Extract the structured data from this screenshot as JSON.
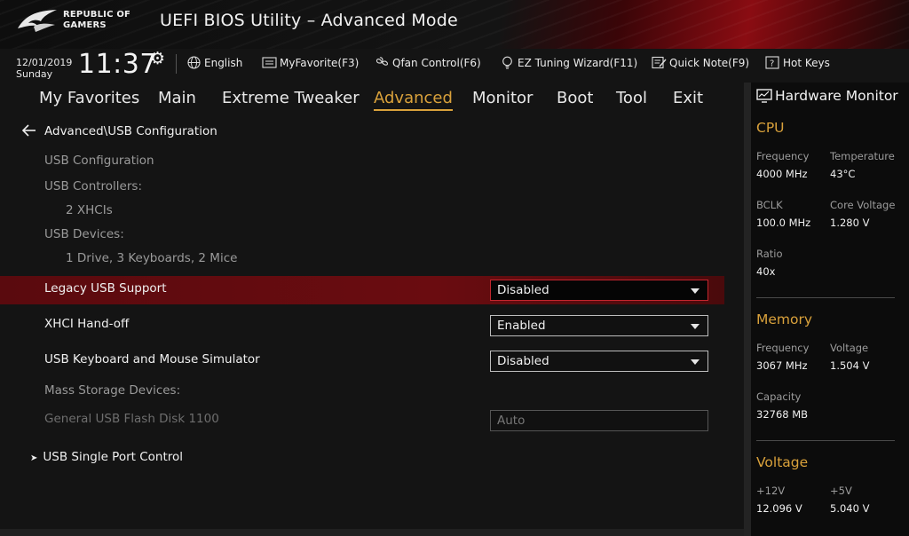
{
  "header": {
    "logo_line1": "REPUBLIC OF",
    "logo_line2": "GAMERS",
    "title": "UEFI BIOS Utility – Advanced Mode"
  },
  "status": {
    "date": "12/01/2019",
    "day": "Sunday",
    "time": "11:37",
    "tools": [
      {
        "label": "English",
        "icon": "globe-icon"
      },
      {
        "label": "MyFavorite(F3)",
        "icon": "favorite-icon"
      },
      {
        "label": "Qfan Control(F6)",
        "icon": "fan-icon"
      },
      {
        "label": "EZ Tuning Wizard(F11)",
        "icon": "bulb-icon"
      },
      {
        "label": "Quick Note(F9)",
        "icon": "note-icon"
      },
      {
        "label": "Hot Keys",
        "icon": "help-icon"
      }
    ]
  },
  "menu": {
    "items": [
      "My Favorites",
      "Main",
      "Extreme Tweaker",
      "Advanced",
      "Monitor",
      "Boot",
      "Tool",
      "Exit"
    ],
    "active": "Advanced"
  },
  "main": {
    "breadcrumb": "Advanced\\USB Configuration",
    "usb_configuration": "USB Configuration",
    "usb_controllers_label": "USB Controllers:",
    "usb_controllers_value": "2 XHCIs",
    "usb_devices_label": "USB Devices:",
    "usb_devices_value": "1 Drive, 3 Keyboards, 2 Mice",
    "settings": [
      {
        "label": "Legacy USB Support",
        "value": "Disabled"
      },
      {
        "label": "XHCI Hand-off",
        "value": "Enabled"
      },
      {
        "label": "USB Keyboard and Mouse Simulator",
        "value": "Disabled"
      }
    ],
    "mass_storage_label": "Mass Storage Devices:",
    "flash_disk_label": "General USB Flash Disk 1100",
    "flash_disk_value": "Auto",
    "submenu": "USB Single Port Control"
  },
  "hw_monitor": {
    "title": "Hardware Monitor",
    "cpu": {
      "title": "CPU",
      "frequency_label": "Frequency",
      "frequency": "4000 MHz",
      "temperature_label": "Temperature",
      "temperature": "43°C",
      "bclk_label": "BCLK",
      "bclk": "100.0 MHz",
      "core_voltage_label": "Core Voltage",
      "core_voltage": "1.280 V",
      "ratio_label": "Ratio",
      "ratio": "40x"
    },
    "memory": {
      "title": "Memory",
      "frequency_label": "Frequency",
      "frequency": "3067 MHz",
      "voltage_label": "Voltage",
      "voltage": "1.504 V",
      "capacity_label": "Capacity",
      "capacity": "32768 MB"
    },
    "voltage": {
      "title": "Voltage",
      "v12_label": "+12V",
      "v12": "12.096 V",
      "v5_label": "+5V",
      "v5": "5.040 V"
    }
  },
  "colors": {
    "accent": "#d9a13b",
    "highlight": "#6a0c10",
    "focus_border": "#c3262e"
  }
}
